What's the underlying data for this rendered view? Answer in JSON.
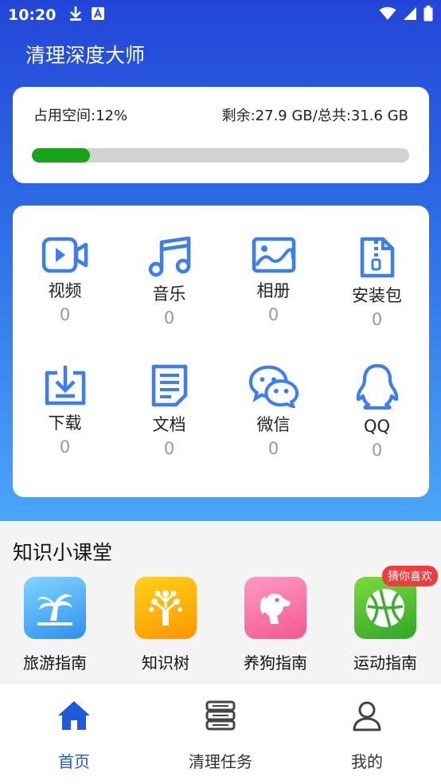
{
  "status_bar": {
    "time": "10:20"
  },
  "app": {
    "title": "清理深度大师"
  },
  "storage": {
    "used_label": "占用空间:12%",
    "remain_label": "剩余:27.9 GB/总共:31.6 GB",
    "used_fraction": 0.155,
    "bar_color": "#16a516"
  },
  "categories": [
    {
      "label": "视频",
      "count": "0",
      "icon": "video-icon"
    },
    {
      "label": "音乐",
      "count": "0",
      "icon": "music-icon"
    },
    {
      "label": "相册",
      "count": "0",
      "icon": "image-icon"
    },
    {
      "label": "安装包",
      "count": "0",
      "icon": "zip-icon"
    },
    {
      "label": "下载",
      "count": "0",
      "icon": "download-icon"
    },
    {
      "label": "文档",
      "count": "0",
      "icon": "document-icon"
    },
    {
      "label": "微信",
      "count": "0",
      "icon": "wechat-icon"
    },
    {
      "label": "QQ",
      "count": "0",
      "icon": "qq-icon"
    }
  ],
  "knowledge": {
    "title": "知识小课堂",
    "items": [
      {
        "label": "旅游指南",
        "icon": "palm-tree-icon"
      },
      {
        "label": "知识树",
        "icon": "tree-icon"
      },
      {
        "label": "养狗指南",
        "icon": "dog-icon"
      },
      {
        "label": "运动指南",
        "icon": "basketball-icon",
        "badge": "猜你喜欢"
      }
    ]
  },
  "nav": {
    "items": [
      {
        "label": "首页",
        "icon": "home-icon",
        "active": true
      },
      {
        "label": "清理任务",
        "icon": "server-icon",
        "active": false
      },
      {
        "label": "我的",
        "icon": "user-icon",
        "active": false
      }
    ]
  },
  "colors": {
    "accent": "#3a7ef0",
    "nav_active": "#1f5bd8",
    "badge": "#f23c3c"
  }
}
